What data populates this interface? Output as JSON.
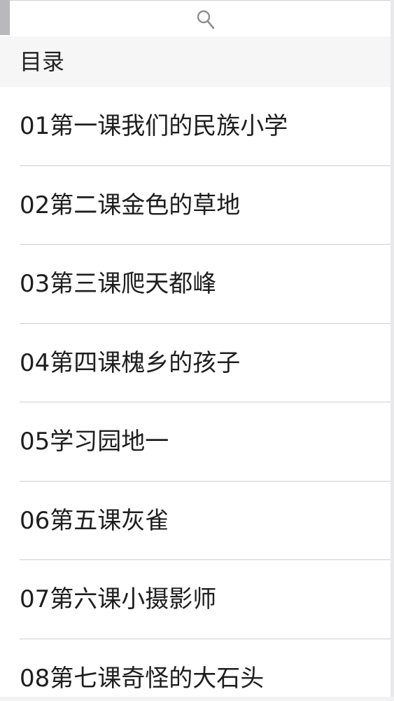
{
  "search": {
    "icon": "search-icon"
  },
  "toc": {
    "header": "目录",
    "items": [
      {
        "label": "01第一课我们的民族小学"
      },
      {
        "label": "02第二课金色的草地"
      },
      {
        "label": "03第三课爬天都峰"
      },
      {
        "label": "04第四课槐乡的孩子"
      },
      {
        "label": "05学习园地一"
      },
      {
        "label": "06第五课灰雀"
      },
      {
        "label": "07第六课小摄影师"
      },
      {
        "label": "08第七课奇怪的大石头"
      }
    ]
  },
  "colors": {
    "header_bg": "#f6f6f7",
    "separator": "#cfcfd3",
    "text": "#1e1e1e"
  }
}
